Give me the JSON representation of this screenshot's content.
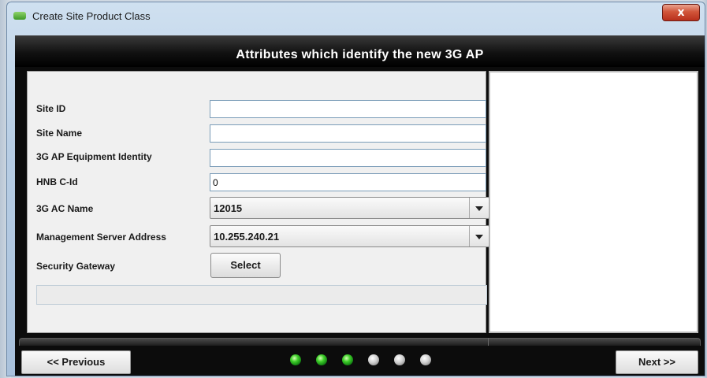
{
  "window": {
    "title": "Create Site Product Class",
    "close_label": "x"
  },
  "header": {
    "title": "Attributes which identify the new 3G AP"
  },
  "form": {
    "site_id": {
      "label": "Site ID",
      "value": ""
    },
    "site_name": {
      "label": "Site Name",
      "value": ""
    },
    "equipment_identity": {
      "label": "3G AP Equipment Identity",
      "value": ""
    },
    "hnb_cid": {
      "label": "HNB C-Id",
      "value": "0"
    },
    "ac_name": {
      "label": "3G AC Name",
      "value": "12015"
    },
    "mgmt_server": {
      "label": "Management Server Address",
      "value": "10.255.240.21"
    },
    "security_gateway": {
      "label": "Security Gateway",
      "button_label": "Select"
    }
  },
  "footer": {
    "previous_label": "<< Previous",
    "next_label": "Next >>",
    "steps_total": 6,
    "steps_completed": 3
  },
  "colors": {
    "header_bg": "#000000",
    "step_active": "#2fbf1f",
    "step_inactive": "#c8c8c8"
  }
}
